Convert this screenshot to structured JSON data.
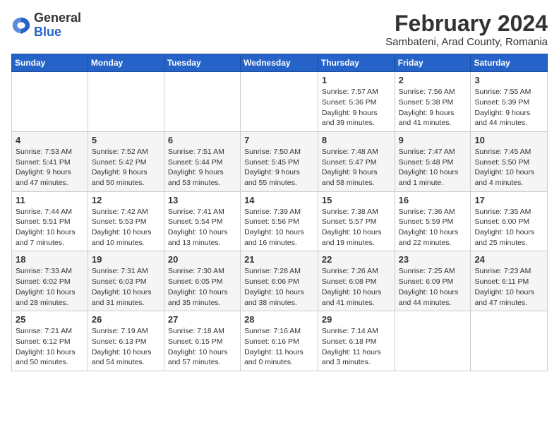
{
  "header": {
    "logo_general": "General",
    "logo_blue": "Blue",
    "month_year": "February 2024",
    "location": "Sambateni, Arad County, Romania"
  },
  "days_of_week": [
    "Sunday",
    "Monday",
    "Tuesday",
    "Wednesday",
    "Thursday",
    "Friday",
    "Saturday"
  ],
  "weeks": [
    [
      {
        "day": "",
        "info": ""
      },
      {
        "day": "",
        "info": ""
      },
      {
        "day": "",
        "info": ""
      },
      {
        "day": "",
        "info": ""
      },
      {
        "day": "1",
        "info": "Sunrise: 7:57 AM\nSunset: 5:36 PM\nDaylight: 9 hours and 39 minutes."
      },
      {
        "day": "2",
        "info": "Sunrise: 7:56 AM\nSunset: 5:38 PM\nDaylight: 9 hours and 41 minutes."
      },
      {
        "day": "3",
        "info": "Sunrise: 7:55 AM\nSunset: 5:39 PM\nDaylight: 9 hours and 44 minutes."
      }
    ],
    [
      {
        "day": "4",
        "info": "Sunrise: 7:53 AM\nSunset: 5:41 PM\nDaylight: 9 hours and 47 minutes."
      },
      {
        "day": "5",
        "info": "Sunrise: 7:52 AM\nSunset: 5:42 PM\nDaylight: 9 hours and 50 minutes."
      },
      {
        "day": "6",
        "info": "Sunrise: 7:51 AM\nSunset: 5:44 PM\nDaylight: 9 hours and 53 minutes."
      },
      {
        "day": "7",
        "info": "Sunrise: 7:50 AM\nSunset: 5:45 PM\nDaylight: 9 hours and 55 minutes."
      },
      {
        "day": "8",
        "info": "Sunrise: 7:48 AM\nSunset: 5:47 PM\nDaylight: 9 hours and 58 minutes."
      },
      {
        "day": "9",
        "info": "Sunrise: 7:47 AM\nSunset: 5:48 PM\nDaylight: 10 hours and 1 minute."
      },
      {
        "day": "10",
        "info": "Sunrise: 7:45 AM\nSunset: 5:50 PM\nDaylight: 10 hours and 4 minutes."
      }
    ],
    [
      {
        "day": "11",
        "info": "Sunrise: 7:44 AM\nSunset: 5:51 PM\nDaylight: 10 hours and 7 minutes."
      },
      {
        "day": "12",
        "info": "Sunrise: 7:42 AM\nSunset: 5:53 PM\nDaylight: 10 hours and 10 minutes."
      },
      {
        "day": "13",
        "info": "Sunrise: 7:41 AM\nSunset: 5:54 PM\nDaylight: 10 hours and 13 minutes."
      },
      {
        "day": "14",
        "info": "Sunrise: 7:39 AM\nSunset: 5:56 PM\nDaylight: 10 hours and 16 minutes."
      },
      {
        "day": "15",
        "info": "Sunrise: 7:38 AM\nSunset: 5:57 PM\nDaylight: 10 hours and 19 minutes."
      },
      {
        "day": "16",
        "info": "Sunrise: 7:36 AM\nSunset: 5:59 PM\nDaylight: 10 hours and 22 minutes."
      },
      {
        "day": "17",
        "info": "Sunrise: 7:35 AM\nSunset: 6:00 PM\nDaylight: 10 hours and 25 minutes."
      }
    ],
    [
      {
        "day": "18",
        "info": "Sunrise: 7:33 AM\nSunset: 6:02 PM\nDaylight: 10 hours and 28 minutes."
      },
      {
        "day": "19",
        "info": "Sunrise: 7:31 AM\nSunset: 6:03 PM\nDaylight: 10 hours and 31 minutes."
      },
      {
        "day": "20",
        "info": "Sunrise: 7:30 AM\nSunset: 6:05 PM\nDaylight: 10 hours and 35 minutes."
      },
      {
        "day": "21",
        "info": "Sunrise: 7:28 AM\nSunset: 6:06 PM\nDaylight: 10 hours and 38 minutes."
      },
      {
        "day": "22",
        "info": "Sunrise: 7:26 AM\nSunset: 6:08 PM\nDaylight: 10 hours and 41 minutes."
      },
      {
        "day": "23",
        "info": "Sunrise: 7:25 AM\nSunset: 6:09 PM\nDaylight: 10 hours and 44 minutes."
      },
      {
        "day": "24",
        "info": "Sunrise: 7:23 AM\nSunset: 6:11 PM\nDaylight: 10 hours and 47 minutes."
      }
    ],
    [
      {
        "day": "25",
        "info": "Sunrise: 7:21 AM\nSunset: 6:12 PM\nDaylight: 10 hours and 50 minutes."
      },
      {
        "day": "26",
        "info": "Sunrise: 7:19 AM\nSunset: 6:13 PM\nDaylight: 10 hours and 54 minutes."
      },
      {
        "day": "27",
        "info": "Sunrise: 7:18 AM\nSunset: 6:15 PM\nDaylight: 10 hours and 57 minutes."
      },
      {
        "day": "28",
        "info": "Sunrise: 7:16 AM\nSunset: 6:16 PM\nDaylight: 11 hours and 0 minutes."
      },
      {
        "day": "29",
        "info": "Sunrise: 7:14 AM\nSunset: 6:18 PM\nDaylight: 11 hours and 3 minutes."
      },
      {
        "day": "",
        "info": ""
      },
      {
        "day": "",
        "info": ""
      }
    ]
  ]
}
